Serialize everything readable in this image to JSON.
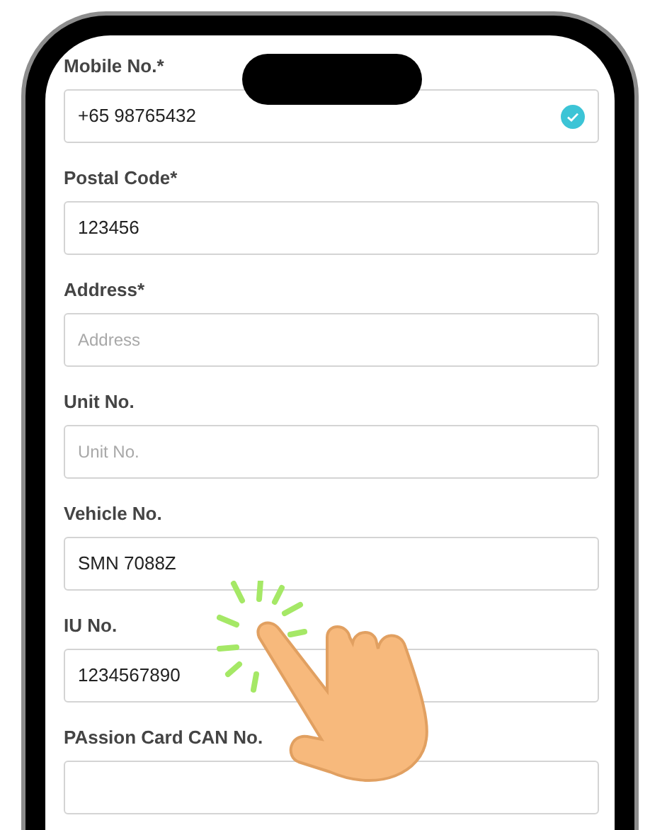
{
  "fields": [
    {
      "label": "Mobile No.*",
      "value": "+65 98765432",
      "verified": true
    },
    {
      "label": "Postal Code*",
      "value": "123456",
      "verified": false
    },
    {
      "label": "Address*",
      "placeholder": "Address",
      "verified": false
    },
    {
      "label": "Unit No.",
      "placeholder": "Unit No.",
      "verified": false
    },
    {
      "label": "Vehicle No.",
      "value": "SMN 7088Z",
      "verified": false
    },
    {
      "label": "IU No.",
      "value": "1234567890",
      "verified": false
    },
    {
      "label": "PAssion Card CAN No.",
      "verified": false
    }
  ]
}
